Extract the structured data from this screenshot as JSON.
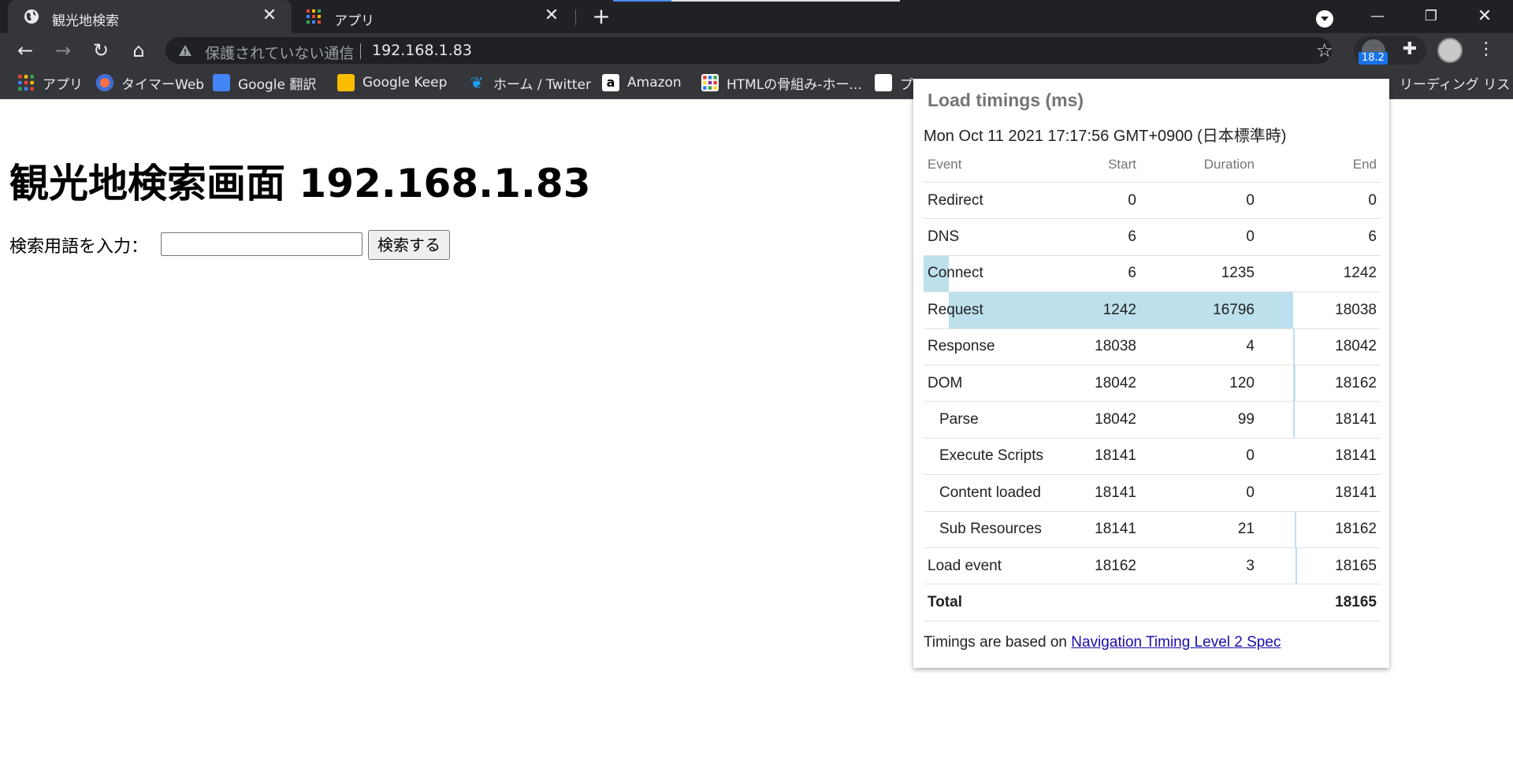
{
  "browser": {
    "tabs": [
      {
        "title": "観光地検索",
        "icon": "globe-icon",
        "active": true
      },
      {
        "title": "アプリ",
        "icon": "apps-grid-icon",
        "active": false
      }
    ],
    "address": {
      "security_text": "保護されていない通信",
      "url": "192.168.1.83"
    },
    "extension_badge": "18.2",
    "bookmarks": [
      {
        "label": "アプリ",
        "icon": "apps-grid-icon"
      },
      {
        "label": "タイマーWeb",
        "icon": "timer-icon"
      },
      {
        "label": "Google 翻訳",
        "icon": "google-translate-icon"
      },
      {
        "label": "Google Keep",
        "icon": "google-keep-icon"
      },
      {
        "label": "ホーム / Twitter",
        "icon": "twitter-icon"
      },
      {
        "label": "Amazon",
        "icon": "amazon-icon"
      },
      {
        "label": "HTMLの骨組み-ホー...",
        "icon": "html-grid-icon"
      },
      {
        "label": "プ",
        "icon": "playstation-icon"
      }
    ],
    "reading_list": "リーディング リスト"
  },
  "page": {
    "heading": "観光地検索画面 192.168.1.83",
    "search_label": "検索用語を入力：",
    "search_value": "",
    "search_button": "検索する"
  },
  "popup": {
    "title": "Load timings (ms)",
    "date": "Mon Oct 11 2021 17:17:56 GMT+0900 (日本標準時)",
    "columns": {
      "event": "Event",
      "start": "Start",
      "duration": "Duration",
      "end": "End"
    },
    "rows": [
      {
        "event": "Redirect",
        "start": "0",
        "duration": "0",
        "end": "0",
        "indent": false
      },
      {
        "event": "DNS",
        "start": "6",
        "duration": "0",
        "end": "6",
        "indent": false
      },
      {
        "event": "Connect",
        "start": "6",
        "duration": "1235",
        "end": "1242",
        "indent": false
      },
      {
        "event": "Request",
        "start": "1242",
        "duration": "16796",
        "end": "18038",
        "indent": false
      },
      {
        "event": "Response",
        "start": "18038",
        "duration": "4",
        "end": "18042",
        "indent": false
      },
      {
        "event": "DOM",
        "start": "18042",
        "duration": "120",
        "end": "18162",
        "indent": false
      },
      {
        "event": "Parse",
        "start": "18042",
        "duration": "99",
        "end": "18141",
        "indent": true
      },
      {
        "event": "Execute Scripts",
        "start": "18141",
        "duration": "0",
        "end": "18141",
        "indent": true
      },
      {
        "event": "Content loaded",
        "start": "18141",
        "duration": "0",
        "end": "18141",
        "indent": true
      },
      {
        "event": "Sub Resources",
        "start": "18141",
        "duration": "21",
        "end": "18162",
        "indent": true
      },
      {
        "event": "Load event",
        "start": "18162",
        "duration": "3",
        "end": "18165",
        "indent": false
      }
    ],
    "total_label": "Total",
    "total_value": "18165",
    "footer_text": "Timings are based on ",
    "footer_link": "Navigation Timing Level 2 Spec"
  }
}
